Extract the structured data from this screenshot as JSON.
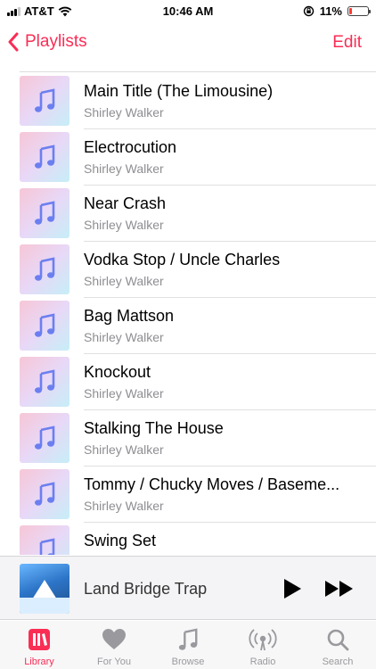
{
  "status_bar": {
    "carrier": "AT&T",
    "time": "10:46 AM",
    "battery": "11%"
  },
  "nav": {
    "back_label": "Playlists",
    "edit_label": "Edit"
  },
  "songs": [
    {
      "title": "Main Title (The Limousine)",
      "artist": "Shirley Walker"
    },
    {
      "title": "Electrocution",
      "artist": "Shirley Walker"
    },
    {
      "title": "Near Crash",
      "artist": "Shirley Walker"
    },
    {
      "title": "Vodka Stop / Uncle Charles",
      "artist": "Shirley Walker"
    },
    {
      "title": "Bag Mattson",
      "artist": "Shirley Walker"
    },
    {
      "title": "Knockout",
      "artist": "Shirley Walker"
    },
    {
      "title": "Stalking The House",
      "artist": "Shirley Walker"
    },
    {
      "title": "Tommy / Chucky Moves / Baseme...",
      "artist": "Shirley Walker"
    },
    {
      "title": "Swing Set",
      "artist": ""
    }
  ],
  "mini_player": {
    "title": "Land Bridge Trap"
  },
  "tabs": [
    {
      "label": "Library",
      "icon": "library-icon",
      "active": true
    },
    {
      "label": "For You",
      "icon": "heart-icon"
    },
    {
      "label": "Browse",
      "icon": "music-note-icon"
    },
    {
      "label": "Radio",
      "icon": "radio-icon"
    },
    {
      "label": "Search",
      "icon": "search-icon"
    }
  ],
  "colors": {
    "accent": "#fa2d55",
    "secondary_text": "#8e8e93",
    "battery_low": "#ff3b30"
  }
}
